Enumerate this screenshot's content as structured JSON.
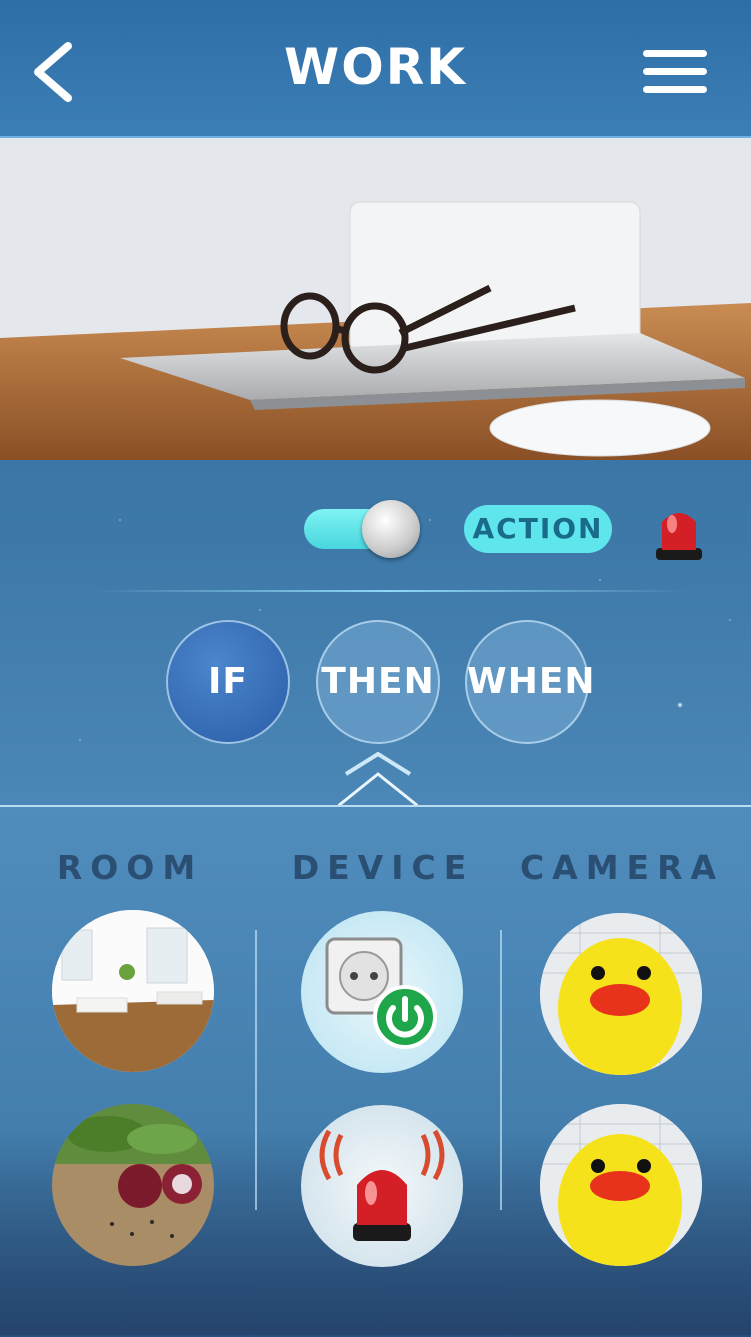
{
  "header": {
    "title": "WORK"
  },
  "controls": {
    "action_label": "ACTION",
    "toggle_on": true
  },
  "tabs": [
    {
      "label": "IF",
      "selected": true
    },
    {
      "label": "THEN",
      "selected": false
    },
    {
      "label": "WHEN",
      "selected": false
    }
  ],
  "columns": [
    {
      "label": "ROOM"
    },
    {
      "label": "DEVICE"
    },
    {
      "label": "CAMERA"
    }
  ],
  "icons": {
    "back": "chevron-left-icon",
    "menu": "hamburger-menu-icon",
    "alarm": "siren-icon",
    "socket": "power-socket-icon",
    "power": "power-icon"
  },
  "colors": {
    "accent": "#5fe6ec",
    "selected_tab": "#2a5da7",
    "power_green": "#1fa54a",
    "siren_red": "#d41f26"
  }
}
